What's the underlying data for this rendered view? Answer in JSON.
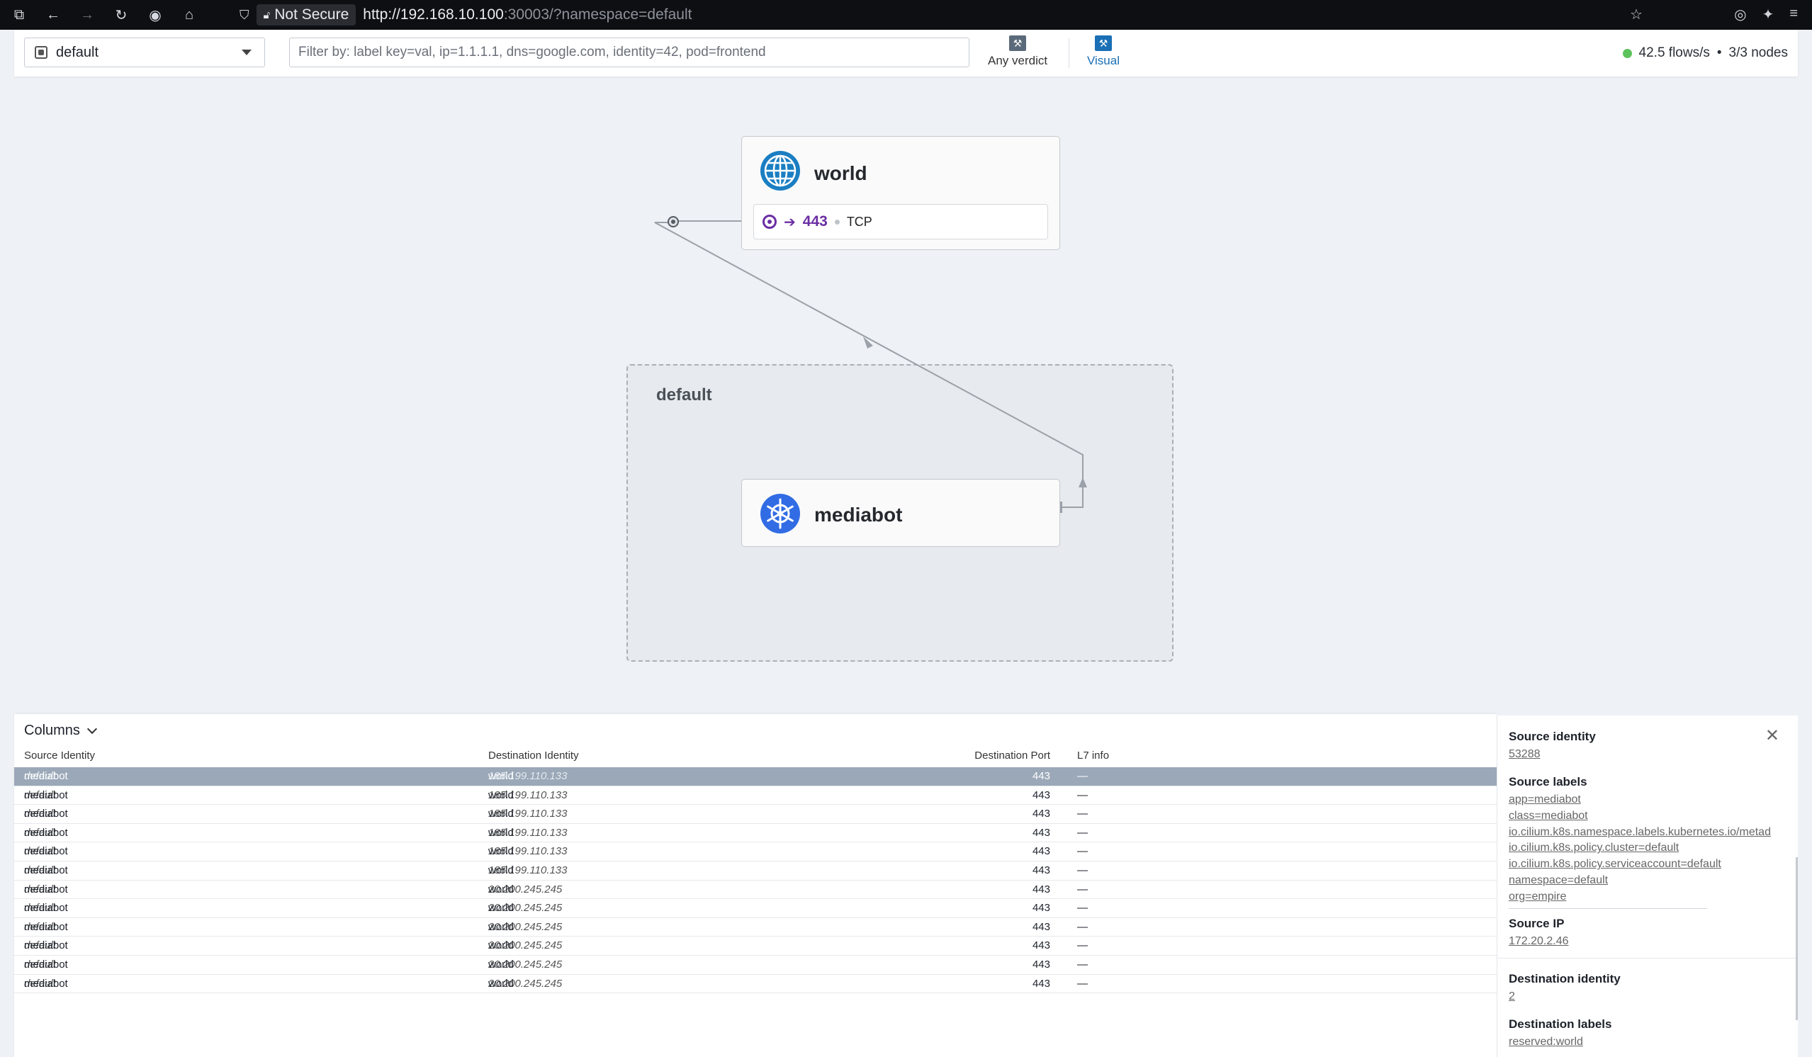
{
  "browser": {
    "not_secure_label": "Not Secure",
    "url_host": "http://192.168.10.100",
    "url_rest": ":30003/?namespace=default"
  },
  "toolbar": {
    "namespace": "default",
    "filter_placeholder": "Filter by: label key=val, ip=1.1.1.1, dns=google.com, identity=42, pod=frontend",
    "verdict_label": "Any verdict",
    "visual_label": "Visual",
    "flows_rate": "42.5 flows/s",
    "nodes": "3/3 nodes"
  },
  "graph": {
    "namespace_label": "default",
    "world": {
      "title": "world",
      "port": "443",
      "protocol": "TCP"
    },
    "mediabot": {
      "title": "mediabot"
    }
  },
  "table": {
    "columns_label": "Columns",
    "headers": [
      "Source Identity",
      "Destination Identity",
      "Destination Port",
      "L7 info"
    ],
    "rows": [
      {
        "src": "mediabot",
        "src_ns": "default",
        "dst": "world",
        "dst_ip": "185.199.110.133",
        "port": "443",
        "l7": "—"
      },
      {
        "src": "mediabot",
        "src_ns": "default",
        "dst": "world",
        "dst_ip": "185.199.110.133",
        "port": "443",
        "l7": "—"
      },
      {
        "src": "mediabot",
        "src_ns": "default",
        "dst": "world",
        "dst_ip": "185.199.110.133",
        "port": "443",
        "l7": "—"
      },
      {
        "src": "mediabot",
        "src_ns": "default",
        "dst": "world",
        "dst_ip": "185.199.110.133",
        "port": "443",
        "l7": "—"
      },
      {
        "src": "mediabot",
        "src_ns": "default",
        "dst": "world",
        "dst_ip": "185.199.110.133",
        "port": "443",
        "l7": "—"
      },
      {
        "src": "mediabot",
        "src_ns": "default",
        "dst": "world",
        "dst_ip": "185.199.110.133",
        "port": "443",
        "l7": "—"
      },
      {
        "src": "mediabot",
        "src_ns": "default",
        "dst": "world",
        "dst_ip": "20.200.245.245",
        "port": "443",
        "l7": "—"
      },
      {
        "src": "mediabot",
        "src_ns": "default",
        "dst": "world",
        "dst_ip": "20.200.245.245",
        "port": "443",
        "l7": "—"
      },
      {
        "src": "mediabot",
        "src_ns": "default",
        "dst": "world",
        "dst_ip": "20.200.245.245",
        "port": "443",
        "l7": "—"
      },
      {
        "src": "mediabot",
        "src_ns": "default",
        "dst": "world",
        "dst_ip": "20.200.245.245",
        "port": "443",
        "l7": "—"
      },
      {
        "src": "mediabot",
        "src_ns": "default",
        "dst": "world",
        "dst_ip": "20.200.245.245",
        "port": "443",
        "l7": "—"
      },
      {
        "src": "mediabot",
        "src_ns": "default",
        "dst": "world",
        "dst_ip": "20.200.245.245",
        "port": "443",
        "l7": "—"
      }
    ]
  },
  "details": {
    "source_identity_label": "Source identity",
    "source_identity": "53288",
    "source_labels_label": "Source labels",
    "source_labels": [
      "app=mediabot",
      "class=mediabot",
      "io.cilium.k8s.namespace.labels.kubernetes.io/metad",
      "io.cilium.k8s.policy.cluster=default",
      "io.cilium.k8s.policy.serviceaccount=default",
      "namespace=default",
      "org=empire"
    ],
    "source_ip_label": "Source IP",
    "source_ip": "172.20.2.46",
    "destination_identity_label": "Destination identity",
    "destination_identity": "2",
    "destination_labels_label": "Destination labels",
    "destination_labels": [
      "reserved:world"
    ]
  },
  "colors": {
    "accent": "#1a6fb5",
    "port_purple": "#6b2ea3",
    "selected_row": "#9aa8b8",
    "status_green": "#5cc35c"
  }
}
